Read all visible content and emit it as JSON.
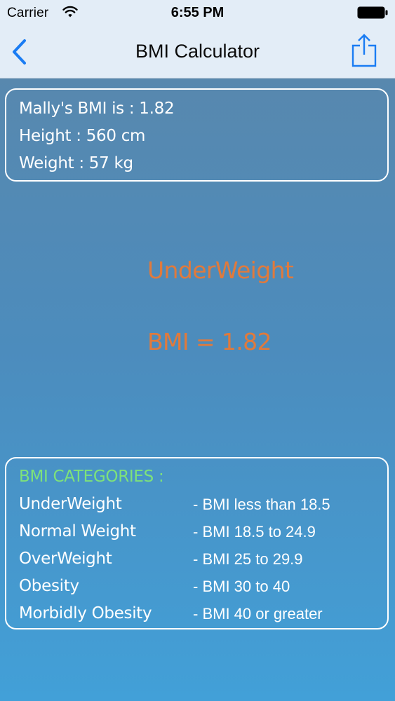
{
  "status_bar": {
    "carrier": "Carrier",
    "time": "6:55 PM",
    "icons": [
      "wifi-icon",
      "battery-icon"
    ]
  },
  "nav": {
    "title": "BMI Calculator",
    "back_icon": "chevron-left-icon",
    "share_icon": "share-icon"
  },
  "info": {
    "bmi_line": "Mally's BMI is : 1.82",
    "height_line": "Height : 560 cm",
    "weight_line": "Weight : 57 kg"
  },
  "result": {
    "status": "UnderWeight",
    "bmi": "BMI = 1.82"
  },
  "categories": {
    "heading": "BMI CATEGORIES :",
    "items": [
      {
        "name": "UnderWeight",
        "range": "- BMI less than 18.5"
      },
      {
        "name": "Normal Weight",
        "range": "- BMI 18.5 to 24.9"
      },
      {
        "name": "OverWeight",
        "range": "- BMI 25 to 29.9"
      },
      {
        "name": "Obesity",
        "range": "- BMI 30 to 40"
      },
      {
        "name": "Morbidly Obesity",
        "range": "- BMI 40 or greater"
      }
    ]
  },
  "colors": {
    "accent_blue": "#1a7cf3",
    "result_orange": "#e07a3c",
    "heading_green": "#7ee27a",
    "nav_background": "#e3edf7"
  }
}
